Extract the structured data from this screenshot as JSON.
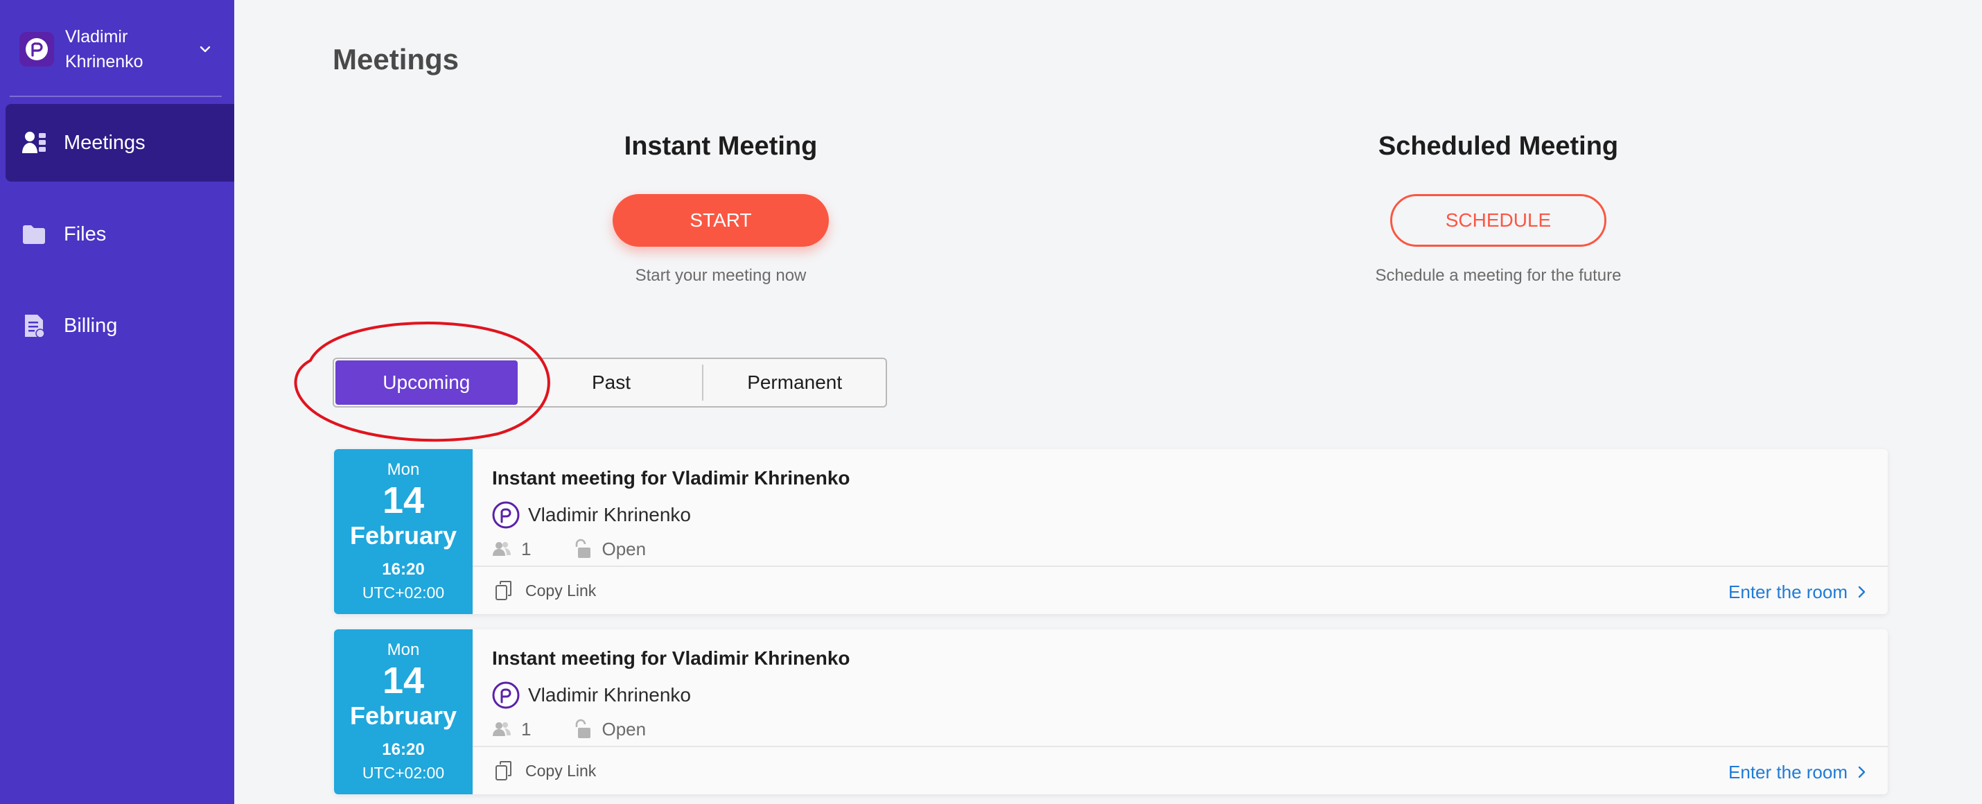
{
  "account": {
    "name": "Vladimir Khrinenko"
  },
  "sidebar": {
    "items": [
      {
        "label": "Meetings",
        "icon": "users-icon",
        "active": true
      },
      {
        "label": "Files",
        "icon": "folder-icon",
        "active": false
      },
      {
        "label": "Billing",
        "icon": "invoice-icon",
        "active": false
      }
    ]
  },
  "main": {
    "title": "Meetings",
    "instant": {
      "title": "Instant Meeting",
      "button": "START",
      "subtitle": "Start your meeting now"
    },
    "scheduled": {
      "title": "Scheduled Meeting",
      "button": "SCHEDULE",
      "subtitle": "Schedule a meeting for the future"
    },
    "tabs": [
      {
        "label": "Upcoming",
        "active": true
      },
      {
        "label": "Past",
        "active": false
      },
      {
        "label": "Permanent",
        "active": false
      }
    ],
    "meetings": [
      {
        "dow": "Mon",
        "day": "14",
        "month": "February",
        "time": "16:20",
        "tz": "UTC+02:00",
        "title": "Instant meeting for Vladimir Khrinenko",
        "host": "Vladimir Khrinenko",
        "participants": "1",
        "access": "Open",
        "copy_link": "Copy Link",
        "enter": "Enter the room"
      },
      {
        "dow": "Mon",
        "day": "14",
        "month": "February",
        "time": "16:20",
        "tz": "UTC+02:00",
        "title": "Instant meeting for Vladimir Khrinenko",
        "host": "Vladimir Khrinenko",
        "participants": "1",
        "access": "Open",
        "copy_link": "Copy Link",
        "enter": "Enter the room"
      }
    ]
  },
  "colors": {
    "sidebar": "#4b35c4",
    "sidebar_active": "#2f1c86",
    "accent": "#fa5743",
    "tab_active": "#6a3fd1",
    "date_block": "#20a7dc",
    "link": "#1f7bd6",
    "annotation": "#e0141e"
  }
}
